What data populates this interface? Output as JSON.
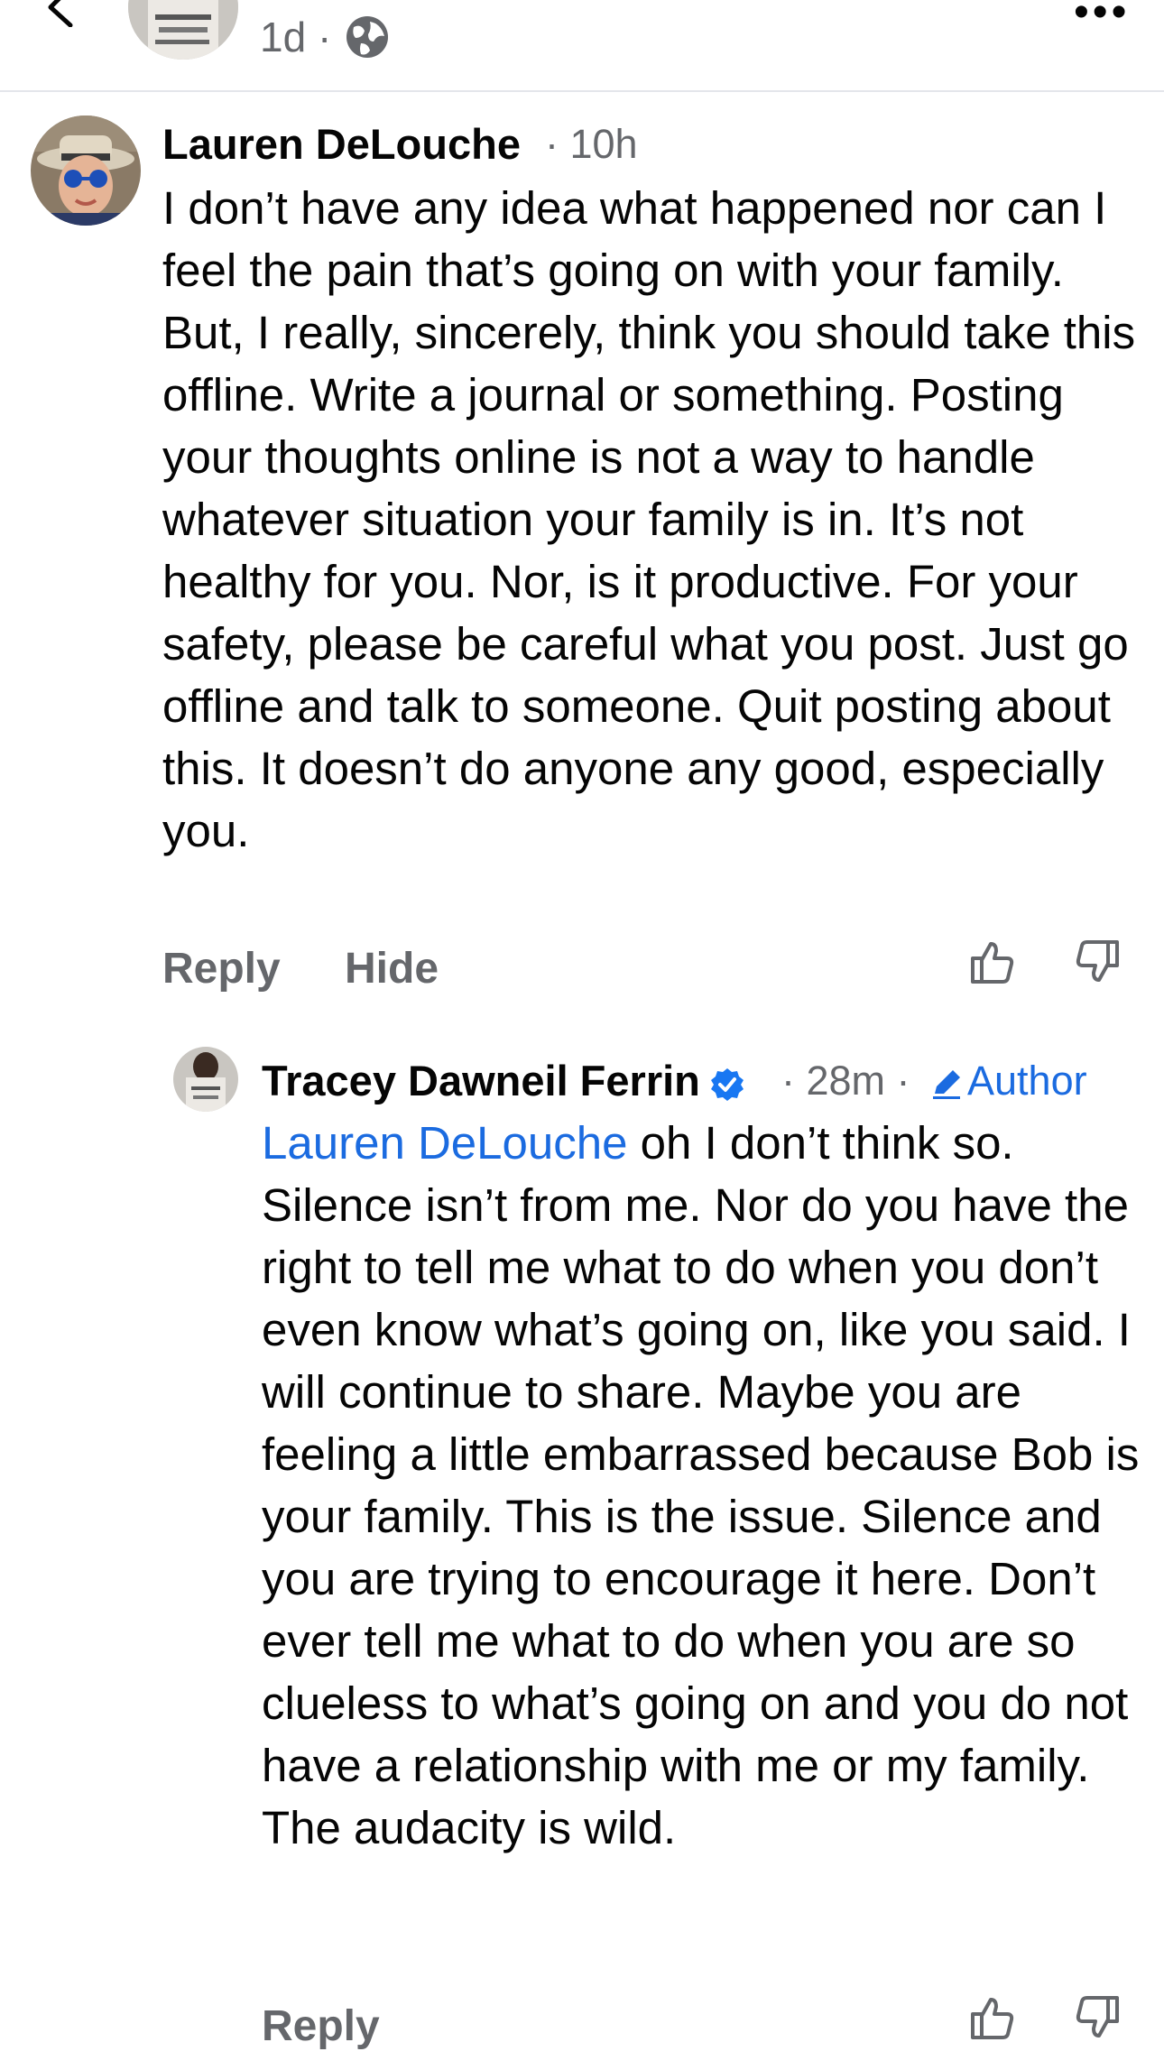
{
  "post": {
    "time": "1d",
    "separator": "·"
  },
  "comments": [
    {
      "name": "Lauren DeLouche",
      "time": "· 10h",
      "text": "I don’t have any idea what happened nor can I feel the pain that’s going on with your family. But, I really, sincerely, think you should take this offline. Write a journal or something. Posting your thoughts online is not a way to handle whatever situation your family is in. It’s not healthy for you. Nor, is it productive. For your safety, please be careful what you post. Just go offline and talk to someone. Quit posting about this. It doesn’t do anyone any good, especially you.",
      "reply_label": "Reply",
      "hide_label": "Hide"
    },
    {
      "name": "Tracey Dawneil Ferrin",
      "time": "· 28m ·",
      "author_label": "Author",
      "mention": "Lauren DeLouche",
      "text": " oh I don’t think so. Silence isn’t from me.  Nor do you have the right to tell me what to do when you don’t even know what’s going on, like you said. I will continue to share. Maybe you are feeling a little embarrassed because Bob is your family. This is the issue. Silence and you are trying to encourage it here. Don’t ever tell me what to do when you are so clueless to what’s going on and you do not have a relationship with me or my family. The audacity is wild.",
      "reply_label": "Reply"
    }
  ],
  "colors": {
    "link": "#1b6be0",
    "muted": "#65676b",
    "text": "#050505",
    "verified": "#1877f2"
  }
}
